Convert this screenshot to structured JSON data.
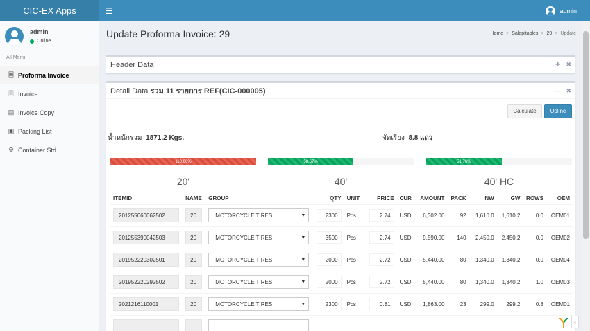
{
  "app": {
    "title": "CIC-EX Apps",
    "menu_icon": "hamburger-icon"
  },
  "topbar": {
    "user": "admin"
  },
  "sidebar": {
    "user": {
      "name": "admin",
      "status": "Online"
    },
    "menu_header": "All Menu",
    "items": [
      {
        "label": "Proforma Invoice",
        "icon": "file-icon",
        "active": true
      },
      {
        "label": "Invoice",
        "icon": "file-icon",
        "active": false
      },
      {
        "label": "Invoice Copy",
        "icon": "copy-icon",
        "active": false
      },
      {
        "label": "Packing List",
        "icon": "packages-icon",
        "active": false
      },
      {
        "label": "Container Std",
        "icon": "gears-icon",
        "active": false
      }
    ]
  },
  "page": {
    "title": "Update Proforma Invoice: 29",
    "breadcrumb": [
      "Home",
      "Salepitables",
      "29",
      "Update"
    ]
  },
  "header_box": {
    "title": "Header Data"
  },
  "detail_box": {
    "title_prefix": "Detail Data ",
    "title_bold": "รวม",
    "title_count": "11",
    "title_suffix": "รายการ REF(CIC-000005)",
    "calculate_label": "Calculate",
    "upline_label": "Upline",
    "weight_label": "น้ำหนักรวม",
    "weight_value": "1871.2 Kgs.",
    "arrange_label": "จัดเรียง",
    "arrange_value": "8.8 แถว"
  },
  "containers": [
    {
      "label": "20'",
      "percent": 110.0,
      "percent_text": "110.00%",
      "color": "#dd4b39"
    },
    {
      "label": "40'",
      "percent": 58.67,
      "percent_text": "58.67%",
      "color": "#00a65a"
    },
    {
      "label": "40' HC",
      "percent": 51.76,
      "percent_text": "51.76%",
      "color": "#00a65a"
    }
  ],
  "table": {
    "columns": [
      "ITEMID",
      "NAME",
      "GROUP",
      "QTY",
      "UNIT",
      "PRICE",
      "CUR",
      "AMOUNT",
      "PACK",
      "NW",
      "GW",
      "ROWS",
      "OEM"
    ],
    "rows": [
      {
        "itemid": "201255060062502",
        "name": "20",
        "group": "MOTORCYCLE TIRES",
        "qty": "2300",
        "unit": "Pcs",
        "price": "2.74",
        "cur": "USD",
        "amount": "6,302.00",
        "pack": "92",
        "nw": "1,610.0",
        "gw": "1,610.2",
        "rows": "0.0",
        "oem": "OEM01"
      },
      {
        "itemid": "201255390042503",
        "name": "20",
        "group": "MOTORCYCLE TIRES",
        "qty": "3500",
        "unit": "Pcs",
        "price": "2.74",
        "cur": "USD",
        "amount": "9,590.00",
        "pack": "140",
        "nw": "2,450.0",
        "gw": "2,450.2",
        "rows": "0.0",
        "oem": "OEM02"
      },
      {
        "itemid": "201952220302501",
        "name": "20",
        "group": "MOTORCYCLE TIRES",
        "qty": "2000",
        "unit": "Pcs",
        "price": "2.72",
        "cur": "USD",
        "amount": "5,440.00",
        "pack": "80",
        "nw": "1,340.0",
        "gw": "1,340.2",
        "rows": "0.0",
        "oem": "OEM04"
      },
      {
        "itemid": "201952220292502",
        "name": "20",
        "group": "MOTORCYCLE TIRES",
        "qty": "2000",
        "unit": "Pcs",
        "price": "2.72",
        "cur": "USD",
        "amount": "5,440.00",
        "pack": "80",
        "nw": "1,340.0",
        "gw": "1,340.2",
        "rows": "1.0",
        "oem": "OEM03"
      },
      {
        "itemid": "2021216110001",
        "name": "20",
        "group": "MOTORCYCLE TIRES",
        "qty": "2300",
        "unit": "Pcs",
        "price": "0.81",
        "cur": "USD",
        "amount": "1,863.00",
        "pack": "23",
        "nw": "299.0",
        "gw": "299.2",
        "rows": "0.8",
        "oem": "OEM01"
      }
    ]
  }
}
